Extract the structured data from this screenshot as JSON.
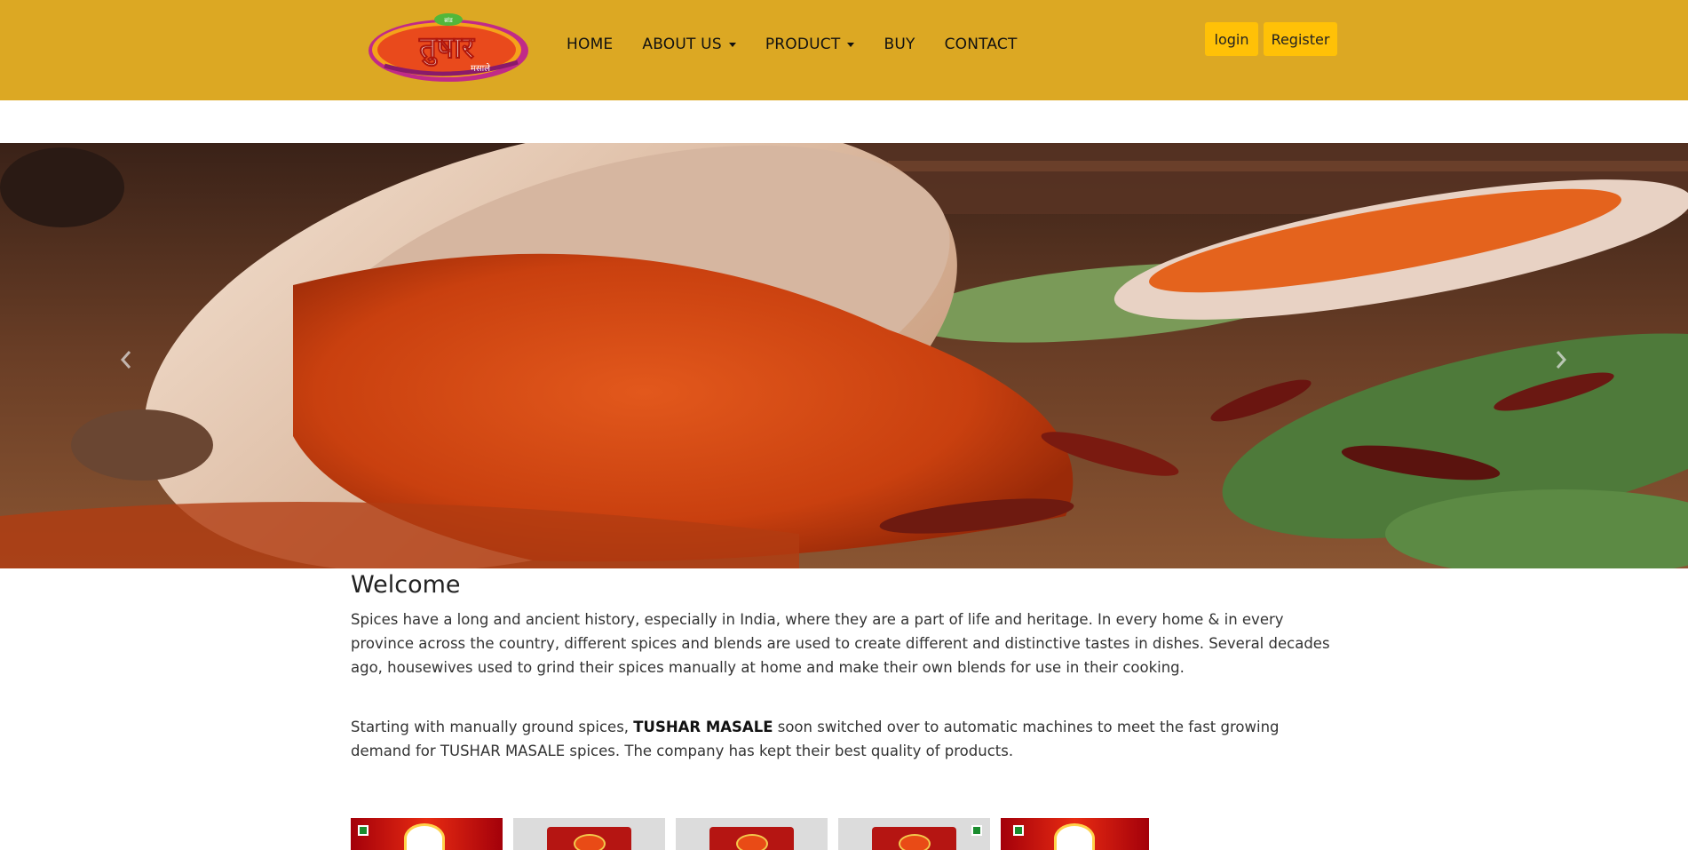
{
  "brand": {
    "logo_text": "तुषार",
    "logo_subtext": "मसाले",
    "logo_badge": "ब्रांड"
  },
  "nav": {
    "items": [
      {
        "label": "HOME",
        "dropdown": false
      },
      {
        "label": "ABOUT US",
        "dropdown": true
      },
      {
        "label": "PRODUCT",
        "dropdown": true
      },
      {
        "label": "BUY",
        "dropdown": false
      },
      {
        "label": "CONTACT",
        "dropdown": false
      }
    ]
  },
  "auth": {
    "login_label": "login",
    "register_label": "Register"
  },
  "carousel": {
    "prev_icon": "chevron-left-icon",
    "next_icon": "chevron-right-icon"
  },
  "welcome": {
    "title": "Welcome",
    "paragraph1": "Spices have a long and ancient history, especially in India, where they are a part of life and heritage. In every home & in every province across the country, different spices and blends are used to create different and distinctive tastes in dishes. Several decades ago, housewives used to grind their spices manually at home and make their own blends for use in their cooking.",
    "paragraph2_before": "Starting with manually ground spices, ",
    "paragraph2_brand": "TUSHAR MASALE",
    "paragraph2_after": " soon switched over to automatic machines to meet the fast growing demand for TUSHAR MASALE spices. The company has kept their best quality of products."
  },
  "colors": {
    "header_bg": "#dca823",
    "button_bg": "#ffc107",
    "text": "#222222"
  }
}
